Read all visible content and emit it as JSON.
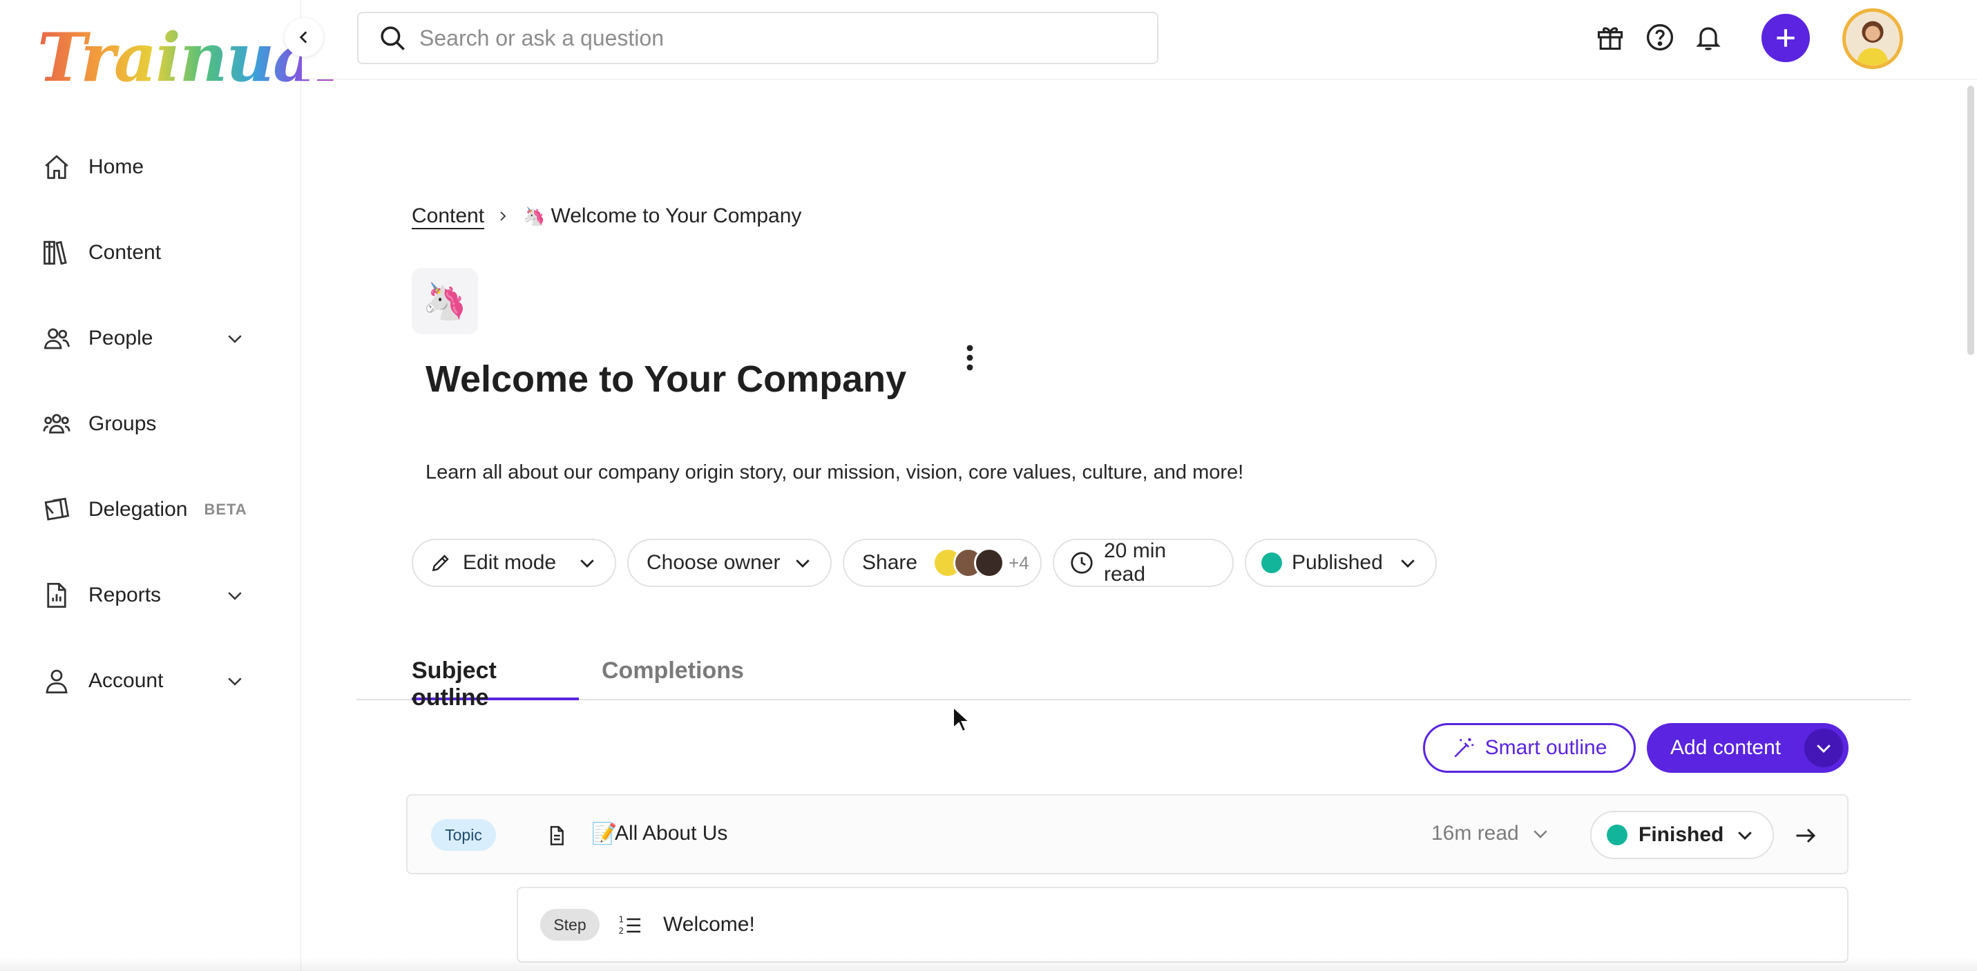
{
  "app": {
    "logo_text": "Trainual"
  },
  "sidebar": {
    "items": [
      {
        "label": "Home",
        "icon": "home-icon",
        "has_chevron": false
      },
      {
        "label": "Content",
        "icon": "books-icon",
        "has_chevron": false
      },
      {
        "label": "People",
        "icon": "people-icon",
        "has_chevron": true
      },
      {
        "label": "Groups",
        "icon": "groups-icon",
        "has_chevron": false
      },
      {
        "label": "Delegation",
        "icon": "delegation-icon",
        "badge": "BETA",
        "has_chevron": false
      },
      {
        "label": "Reports",
        "icon": "report-icon",
        "has_chevron": true
      },
      {
        "label": "Account",
        "icon": "account-icon",
        "has_chevron": true
      }
    ]
  },
  "search": {
    "placeholder": "Search or ask a question"
  },
  "header_icons": [
    "gift-icon",
    "help-icon",
    "bell-icon",
    "plus-icon",
    "avatar"
  ],
  "breadcrumb": {
    "root": "Content",
    "emoji": "🦄",
    "current": "Welcome to Your Company"
  },
  "subject": {
    "emoji": "🦄",
    "title": "Welcome to Your Company",
    "description": "Learn all about our company origin story, our mission, vision, core values, culture, and more!"
  },
  "controls": {
    "edit_mode": "Edit mode",
    "choose_owner": "Choose owner",
    "share": "Share",
    "share_extra": "+4",
    "read_time": "20 min read",
    "status": "Published"
  },
  "tabs": [
    {
      "label": "Subject outline",
      "active": true
    },
    {
      "label": "Completions",
      "active": false
    }
  ],
  "actions": {
    "smart_outline": "Smart outline",
    "add_content": "Add content"
  },
  "outline": {
    "topic": {
      "tag": "Topic",
      "emoji": "📝",
      "title": "All About Us",
      "read_time": "16m read",
      "status": "Finished"
    },
    "step": {
      "tag": "Step",
      "title": "Welcome!"
    }
  },
  "colors": {
    "accent": "#5a24e0",
    "status_green": "#13b59a",
    "topic_tag_bg": "#d8eefc",
    "step_tag_bg": "#e2e2e2"
  }
}
